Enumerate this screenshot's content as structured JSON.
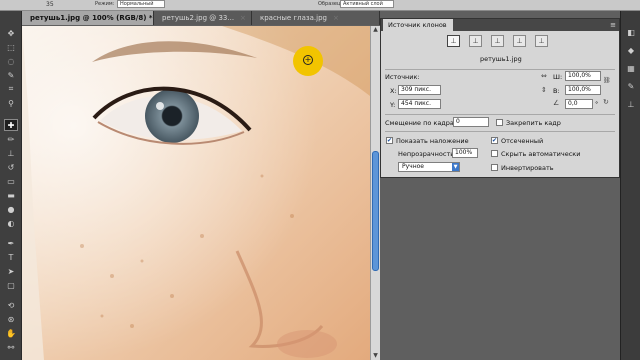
{
  "options_bar": {
    "brush_size": "35",
    "mode_label": "Режим:",
    "mode_value": "Нормальный",
    "sample_label": "Образец:",
    "sample_value": "Активный слой"
  },
  "tabs": [
    {
      "label": "ретушь1.jpg @ 100% (RGB/8) *",
      "active": true
    },
    {
      "label": "ретушь2.jpg @ 33...",
      "active": false
    },
    {
      "label": "красные глаза.jpg",
      "active": false
    }
  ],
  "clone_panel": {
    "title": "Источник клонов",
    "file_name": "ретушь1.jpg",
    "source_label": "Источник:",
    "x_label": "X:",
    "x_value": "309 пикс.",
    "y_label": "Y:",
    "y_value": "454 пикс.",
    "w_label": "Ш:",
    "w_value": "100,0%",
    "h_label": "В:",
    "h_value": "100,0%",
    "angle_value": "0,0",
    "angle_unit": "°",
    "frame_offset_label": "Смещение по кадрам:",
    "frame_offset_value": "0",
    "lock_frame_label": "Закрепить кадр",
    "show_overlay_label": "Показать наложение",
    "opacity_label": "Непрозрачность:",
    "opacity_value": "100%",
    "blend_value": "Ручное",
    "clipped_label": "Отсеченный",
    "auto_hide_label": "Скрыть автоматически",
    "invert_label": "Инвертировать",
    "show_overlay_checked": true,
    "clipped_checked": true,
    "lock_frame_checked": false,
    "auto_hide_checked": false,
    "invert_checked": false
  },
  "icons": {
    "brush_cursor": "clone-stamp-cursor-icon",
    "panel_menu": "panel-menu-icon"
  },
  "colors": {
    "accent_blue": "#3d78c9",
    "cursor_yellow": "#f2c400",
    "panel_bg": "#d6d6d6",
    "dark_ui": "#3f3f3f"
  }
}
